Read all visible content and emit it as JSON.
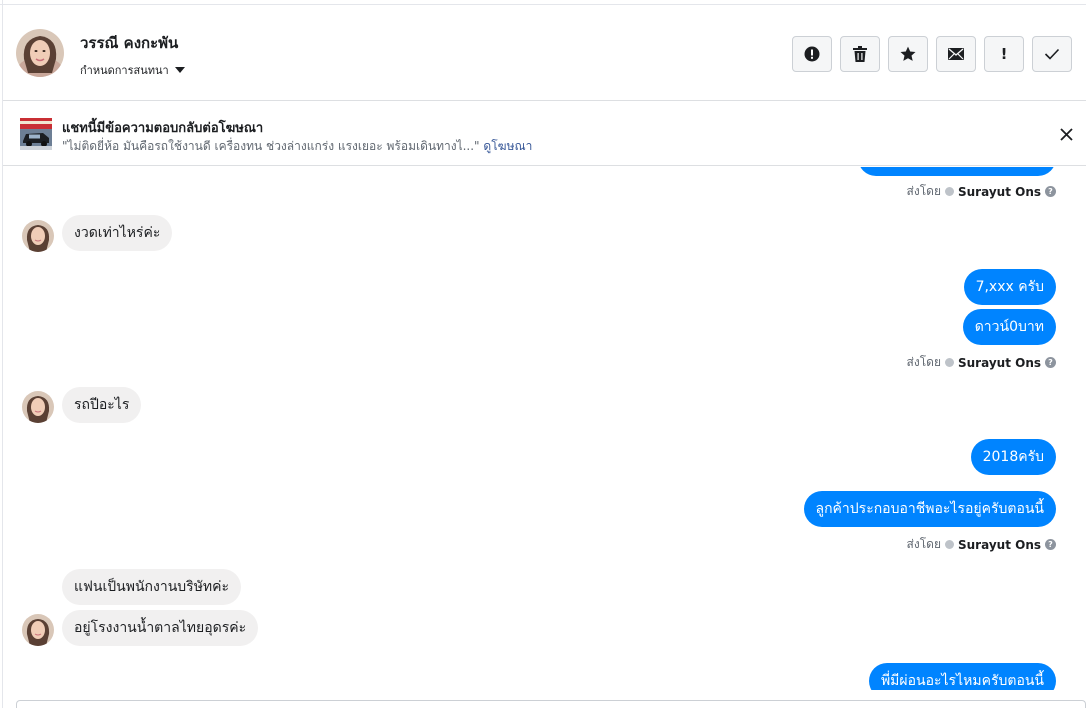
{
  "header": {
    "contact_name": "วรรณี คงกะพัน",
    "status_label": "กำหนดการสนทนา",
    "actions": [
      {
        "icon": "alert-circle-icon"
      },
      {
        "icon": "trash-icon"
      },
      {
        "icon": "star-icon"
      },
      {
        "icon": "envelope-icon"
      },
      {
        "icon": "exclamation-icon",
        "label": "!"
      },
      {
        "icon": "checkmark-icon"
      }
    ]
  },
  "ad_banner": {
    "title": "แชทนี้มีข้อความตอบกลับต่อโฆษณา",
    "quote": "\"ไม่ติดยี่ห้อ มันคือรถใช้งานดี เครื่องทน ช่วงล่างแกร่ง แรงเยอะ พร้อมเดินทางไ...\"",
    "link": "ดูโฆษณา"
  },
  "messages": [
    {
      "from": "customer",
      "text": "งวดเท่าไหร่ค่ะ"
    },
    {
      "from": "page",
      "text": "7,xxx ครับ"
    },
    {
      "from": "page",
      "text": "ดาวน์0บาท"
    },
    {
      "from": "customer",
      "text": "รถปีอะไร"
    },
    {
      "from": "page",
      "text": "2018ครับ"
    },
    {
      "from": "page",
      "text": "ลูกค้าประกอบอาชีพอะไรอยู่ครับตอนนี้"
    },
    {
      "from": "customer",
      "text": "แฟนเป็นพนักงานบริษัทค่ะ"
    },
    {
      "from": "customer",
      "text": "อยู่โรงงานน้ำตาลไทยอุดรค่ะ"
    },
    {
      "from": "page",
      "text": "พี่มีผ่อนอะไรไหมครับตอนนี้"
    }
  ],
  "sent_by": {
    "prefix": "ส่งโดย",
    "agent": "Surayut Ons",
    "help": "?"
  },
  "colors": {
    "outgoing_bubble": "#0084ff",
    "incoming_bubble": "#f1f0f0",
    "link": "#385898"
  }
}
